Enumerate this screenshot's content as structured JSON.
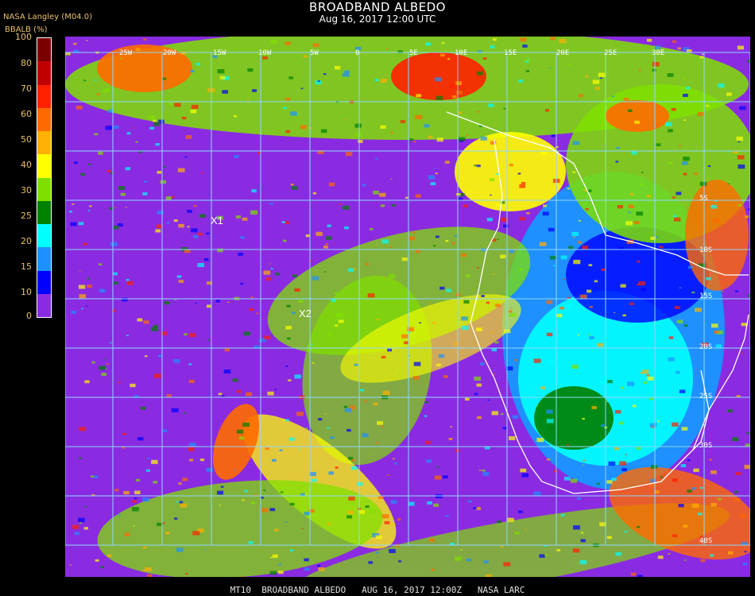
{
  "header": {
    "title": "BROADBAND ALBEDO",
    "subtitle": "Aug 16, 2017 12:00 UTC",
    "source": "NASA Langley (M04.0)"
  },
  "colorbar": {
    "label": "BBALB (%)",
    "ticks": [
      "100",
      "80",
      "70",
      "60",
      "50",
      "40",
      "30",
      "25",
      "20",
      "15",
      "10",
      "0"
    ],
    "colors": [
      "#7a0000",
      "#c00000",
      "#ff2000",
      "#ff6a00",
      "#ffb000",
      "#ffff00",
      "#7fe000",
      "#008000",
      "#00ffff",
      "#1e90ff",
      "#0000ff",
      "#8a2be2"
    ]
  },
  "map": {
    "lon_labels": [
      "25W",
      "20W",
      "15W",
      "10W",
      "5W",
      "0",
      "5E",
      "10E",
      "15E",
      "20E",
      "25E",
      "30E"
    ],
    "lat_labels": [
      "5S",
      "10S",
      "15S",
      "20S",
      "25S",
      "30S",
      "40S"
    ],
    "markers": [
      {
        "label": "X1"
      },
      {
        "label": "X2"
      }
    ]
  },
  "footer": {
    "text": "MT10  BROADBAND ALBEDO   AUG 16, 2017 12:00Z   NASA LARC"
  }
}
